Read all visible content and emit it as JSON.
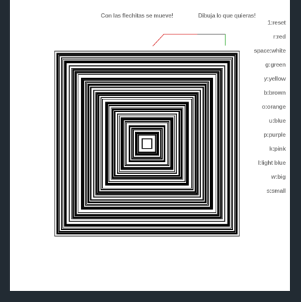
{
  "captions": {
    "left": "Con las flechitas se mueve!",
    "right": "Dibuja lo que quieras!"
  },
  "key_legend": [
    {
      "label": "1:reset",
      "color": "#000000"
    },
    {
      "label": "r:red",
      "color": "#ff0000"
    },
    {
      "label": "space:white",
      "color": "#ffffff"
    },
    {
      "label": "g:green",
      "color": "#00aa00"
    },
    {
      "label": "y:yellow",
      "color": "#ffd800"
    },
    {
      "label": "b:brown",
      "color": "#8b4513"
    },
    {
      "label": "o:orange",
      "color": "#ff8800"
    },
    {
      "label": "u:blue",
      "color": "#0000ff"
    },
    {
      "label": "p:purple",
      "color": "#800080"
    },
    {
      "label": "k:pink",
      "color": "#ff69b4"
    },
    {
      "label": "l:light blue",
      "color": "#87cefa"
    },
    {
      "label": "w:big",
      "color": null
    },
    {
      "label": "s:small",
      "color": null
    }
  ],
  "colors": {
    "page_frame": "#222b33",
    "canvas": "#ffffff",
    "caption_text": "#7a7a7a",
    "drawing_ink": "#000000",
    "preview_red": "#e05050",
    "preview_green": "#2eaa2e",
    "preview_gray": "#666666"
  }
}
